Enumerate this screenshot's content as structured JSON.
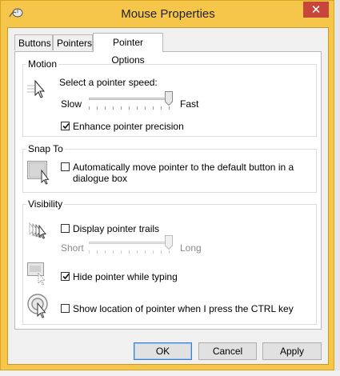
{
  "window": {
    "title": "Mouse Properties",
    "close_glyph": "✕"
  },
  "tabs": [
    {
      "label": "Buttons",
      "active": false
    },
    {
      "label": "Pointers",
      "active": false
    },
    {
      "label": "Pointer Options",
      "active": true
    }
  ],
  "motion": {
    "heading": "Motion",
    "speed_label": "Select a pointer speed:",
    "slow_label": "Slow",
    "fast_label": "Fast",
    "speed_value_fraction": 0.96,
    "enhance_label": "Enhance pointer precision",
    "enhance_checked": true,
    "icon": "pointer-motion-icon"
  },
  "snap_to": {
    "heading": "Snap To",
    "auto_move_label_line1": "Automatically move pointer to the default button in a",
    "auto_move_label_line2": "dialogue box",
    "auto_move_checked": false,
    "icon": "snap-to-button-icon"
  },
  "visibility": {
    "heading": "Visibility",
    "trails_label": "Display pointer trails",
    "trails_checked": false,
    "short_label": "Short",
    "long_label": "Long",
    "trails_value_fraction": 0.96,
    "trails_enabled": false,
    "hide_typing_label": "Hide pointer while typing",
    "hide_typing_checked": true,
    "show_location_label": "Show location of pointer when I press the CTRL key",
    "show_location_checked": false,
    "icons": [
      "pointer-trails-icon",
      "hide-pointer-typing-icon",
      "pointer-location-icon"
    ]
  },
  "buttons": {
    "ok": "OK",
    "cancel": "Cancel",
    "apply": "Apply"
  },
  "colors": {
    "frame": "#f5c64a",
    "close": "#c8453a",
    "accent": "#3c7fd1"
  }
}
